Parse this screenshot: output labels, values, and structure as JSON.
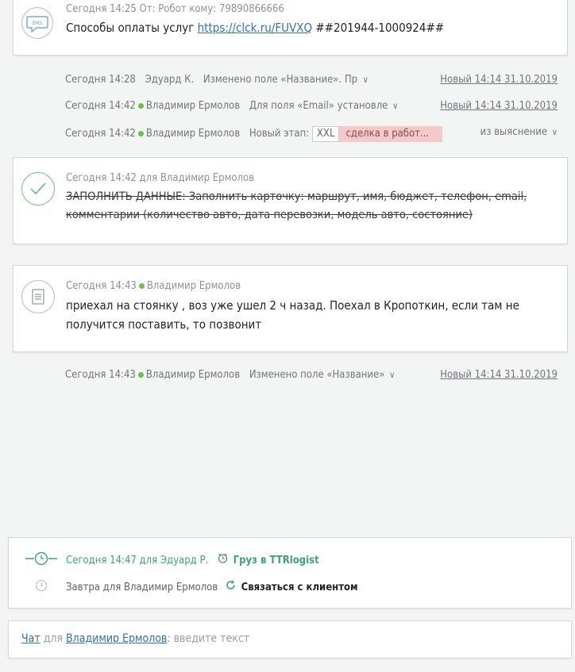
{
  "sms": {
    "meta": "Сегодня 14:25 От: Робот кому: 79890866666",
    "text_prefix": "Способы оплаты услуг",
    "link": "https://clck.ru/FUVXQ",
    "text_suffix": "##201944-1000924##",
    "icon_label": "SMS"
  },
  "events": [
    {
      "time": "Сегодня 14:28",
      "author": "Эдуард К.",
      "text": "Изменено поле «Название». Предыдущ",
      "status": "Новый 14:14 31.10.2019"
    },
    {
      "time": "Сегодня 14:42",
      "author": "Владимир Ермолов",
      "text": "Для поля «Email» установле",
      "status": "Новый 14:14 31.10.2019"
    },
    {
      "time": "Сегодня 14:42",
      "author": "Владимир Ермолов",
      "text": "Новый этап:",
      "stage_from": "XXL",
      "stage_to": "сделка в работ...",
      "stage_source": "из выяснение"
    }
  ],
  "task": {
    "meta": "Сегодня 14:42  для Владимир Ермолов",
    "text": "ЗАПОЛНИТЬ ДАННЫЕ: Заполнить карточку: маршрут, имя, бюджет, телефон, email, комментарии (количество авто, дата перевозки, модель авто, состояние)"
  },
  "note": {
    "time": "Сегодня 14:43",
    "author": "Владимир Ермолов",
    "text": "приехал на стоянку , воз уже ушел 2 ч назад. Поехал в Кропоткин, если там не получится поставить, то позвонит"
  },
  "event4": {
    "time": "Сегодня 14:43",
    "author": "Владимир Ермолов",
    "text": "Изменено поле «Название»",
    "status": "Новый 14:14 31.10.2019"
  },
  "upcoming": [
    {
      "when": "Сегодня 14:47 для Эдуард Р.",
      "task": "Груз в TTRlogist"
    },
    {
      "when": "Завтра для Владимир Ермолов",
      "task": "Связаться с клиентом"
    }
  ],
  "chat": {
    "mode": "Чат",
    "for": "для",
    "user": "Владимир Ермолов",
    "placeholder": ": введите текст"
  },
  "colors": {
    "accent_green": "#3aa576",
    "link_blue": "#2f73b6",
    "stage_pink": "#f5c9c9"
  }
}
